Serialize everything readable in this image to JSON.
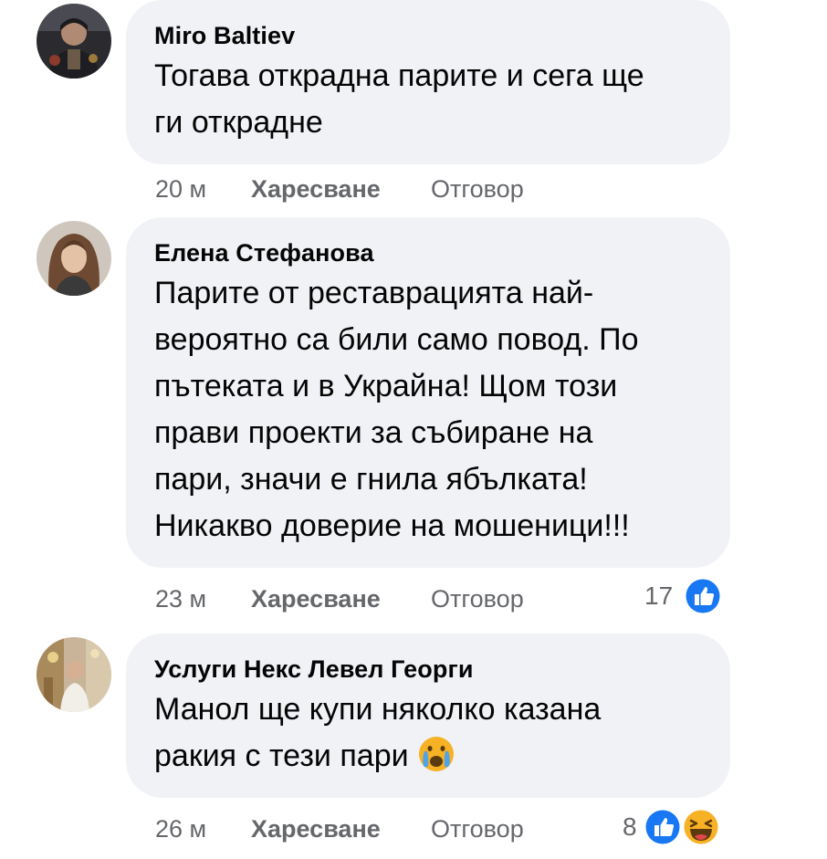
{
  "comments": [
    {
      "author": "Miro Baltiev",
      "text": "Тогава открадна парите и сега ще\nги открадне",
      "time": "20 м",
      "like_label": "Харесване",
      "reply_label": "Отговор"
    },
    {
      "author": "Елена Стефанова",
      "text": "Парите от реставрацията най-\nвероятно са били само повод. По\nпътеката и в Украйна! Щом този\nправи проекти за събиране на\nпари, значи е гнила ябълката!\nНикакво доверие на мошеници!!!",
      "time": "23 м",
      "like_label": "Харесване",
      "reply_label": "Отговор",
      "reaction_count": "17",
      "reaction_icons": [
        "like-icon"
      ]
    },
    {
      "author": "Услуги Некс Левел Георги",
      "text": "Манол ще купи няколко казана\nракия с тези пари ",
      "text_emoji": "crying-face-emoji",
      "time": "26 м",
      "like_label": "Харесване",
      "reply_label": "Отговор",
      "reaction_count": "8",
      "reaction_icons": [
        "like-icon",
        "haha-icon"
      ]
    }
  ],
  "colors": {
    "bubble_background": "#f0f2f5",
    "secondary_text": "#65676b",
    "like_blue": "#1877f2",
    "haha_yellow": "#f7b125"
  }
}
